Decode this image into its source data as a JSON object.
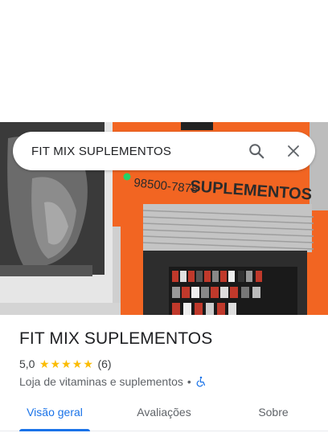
{
  "search": {
    "query": "FIT MIX SUPLEMENTOS"
  },
  "photo": {
    "sign_text": "SUPLEMENTOS",
    "phone": "98500-7878"
  },
  "place": {
    "name": "FIT MIX SUPLEMENTOS",
    "rating": "5,0",
    "stars": 5,
    "review_count": "(6)",
    "category": "Loja de vitaminas e suplementos",
    "separator": "•"
  },
  "tabs": [
    {
      "label": "Visão geral",
      "active": true
    },
    {
      "label": "Avaliações",
      "active": false
    },
    {
      "label": "Sobre",
      "active": false
    }
  ],
  "colors": {
    "accent": "#1a73e8",
    "star": "#fbbc04",
    "sign": "#f26522"
  }
}
